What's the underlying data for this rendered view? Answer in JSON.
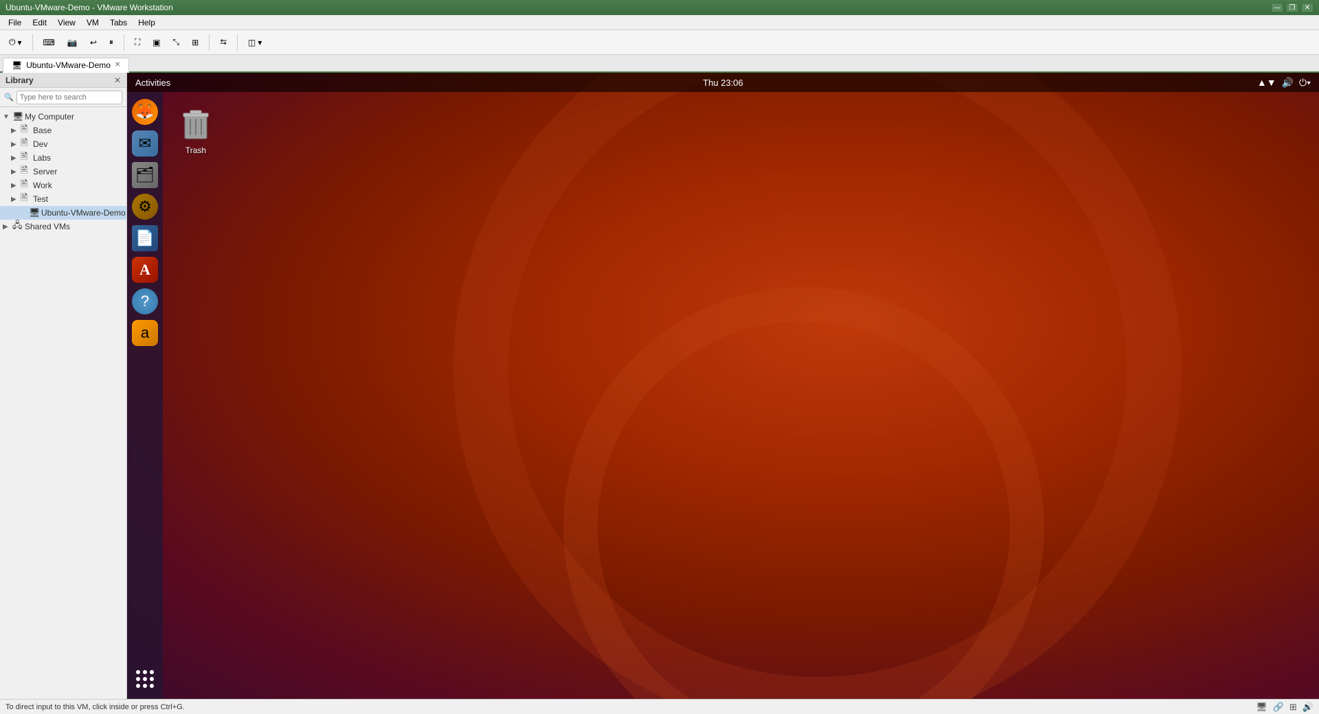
{
  "window": {
    "title": "Ubuntu-VMware-Demo - VMware Workstation",
    "controls": {
      "minimize": "—",
      "restore": "❐",
      "close": "✕"
    }
  },
  "menubar": {
    "items": [
      "File",
      "Edit",
      "View",
      "VM",
      "Tabs",
      "Help"
    ]
  },
  "toolbar": {
    "buttons": [
      {
        "label": "▐▌",
        "name": "power-button"
      },
      {
        "label": "⟳",
        "name": "revert-button"
      },
      {
        "label": "⏸",
        "name": "pause-button"
      },
      {
        "label": "⏹",
        "name": "stop-button"
      }
    ]
  },
  "tabs": {
    "active": "Ubuntu-VMware-Demo",
    "items": [
      {
        "label": "Ubuntu-VMware-Demo",
        "active": true
      }
    ]
  },
  "library": {
    "title": "Library",
    "close_btn": "✕",
    "search_placeholder": "Type here to search",
    "tree": {
      "my_computer": {
        "label": "My Computer",
        "expanded": true,
        "children": [
          {
            "label": "Base",
            "indent": 1
          },
          {
            "label": "Dev",
            "indent": 1
          },
          {
            "label": "Labs",
            "indent": 1
          },
          {
            "label": "Server",
            "indent": 1
          },
          {
            "label": "Work",
            "indent": 1
          },
          {
            "label": "Test",
            "indent": 1
          },
          {
            "label": "Ubuntu-VMware-Demo",
            "indent": 2,
            "selected": true
          }
        ]
      },
      "shared_vms": {
        "label": "Shared VMs",
        "expanded": false
      }
    }
  },
  "ubuntu": {
    "topbar": {
      "activities": "Activities",
      "clock": "Thu 23:06"
    },
    "desktop": {
      "trash": {
        "label": "Trash"
      }
    },
    "dock": {
      "items": [
        {
          "name": "firefox",
          "emoji": "🦊",
          "label": "Firefox"
        },
        {
          "name": "mail",
          "emoji": "✉",
          "label": "Mail"
        },
        {
          "name": "files",
          "emoji": "🗂",
          "label": "Files"
        },
        {
          "name": "settings",
          "emoji": "⚙",
          "label": "Settings"
        },
        {
          "name": "writer",
          "emoji": "📄",
          "label": "Writer"
        },
        {
          "name": "appstore",
          "emoji": "A",
          "label": "App Store"
        },
        {
          "name": "help",
          "emoji": "?",
          "label": "Help"
        },
        {
          "name": "amazon",
          "emoji": "a",
          "label": "Amazon"
        }
      ]
    }
  },
  "statusbar": {
    "message": "To direct input to this VM, click inside or press Ctrl+G.",
    "icons": [
      "🖥",
      "📶",
      "🔗",
      "🖨"
    ]
  }
}
